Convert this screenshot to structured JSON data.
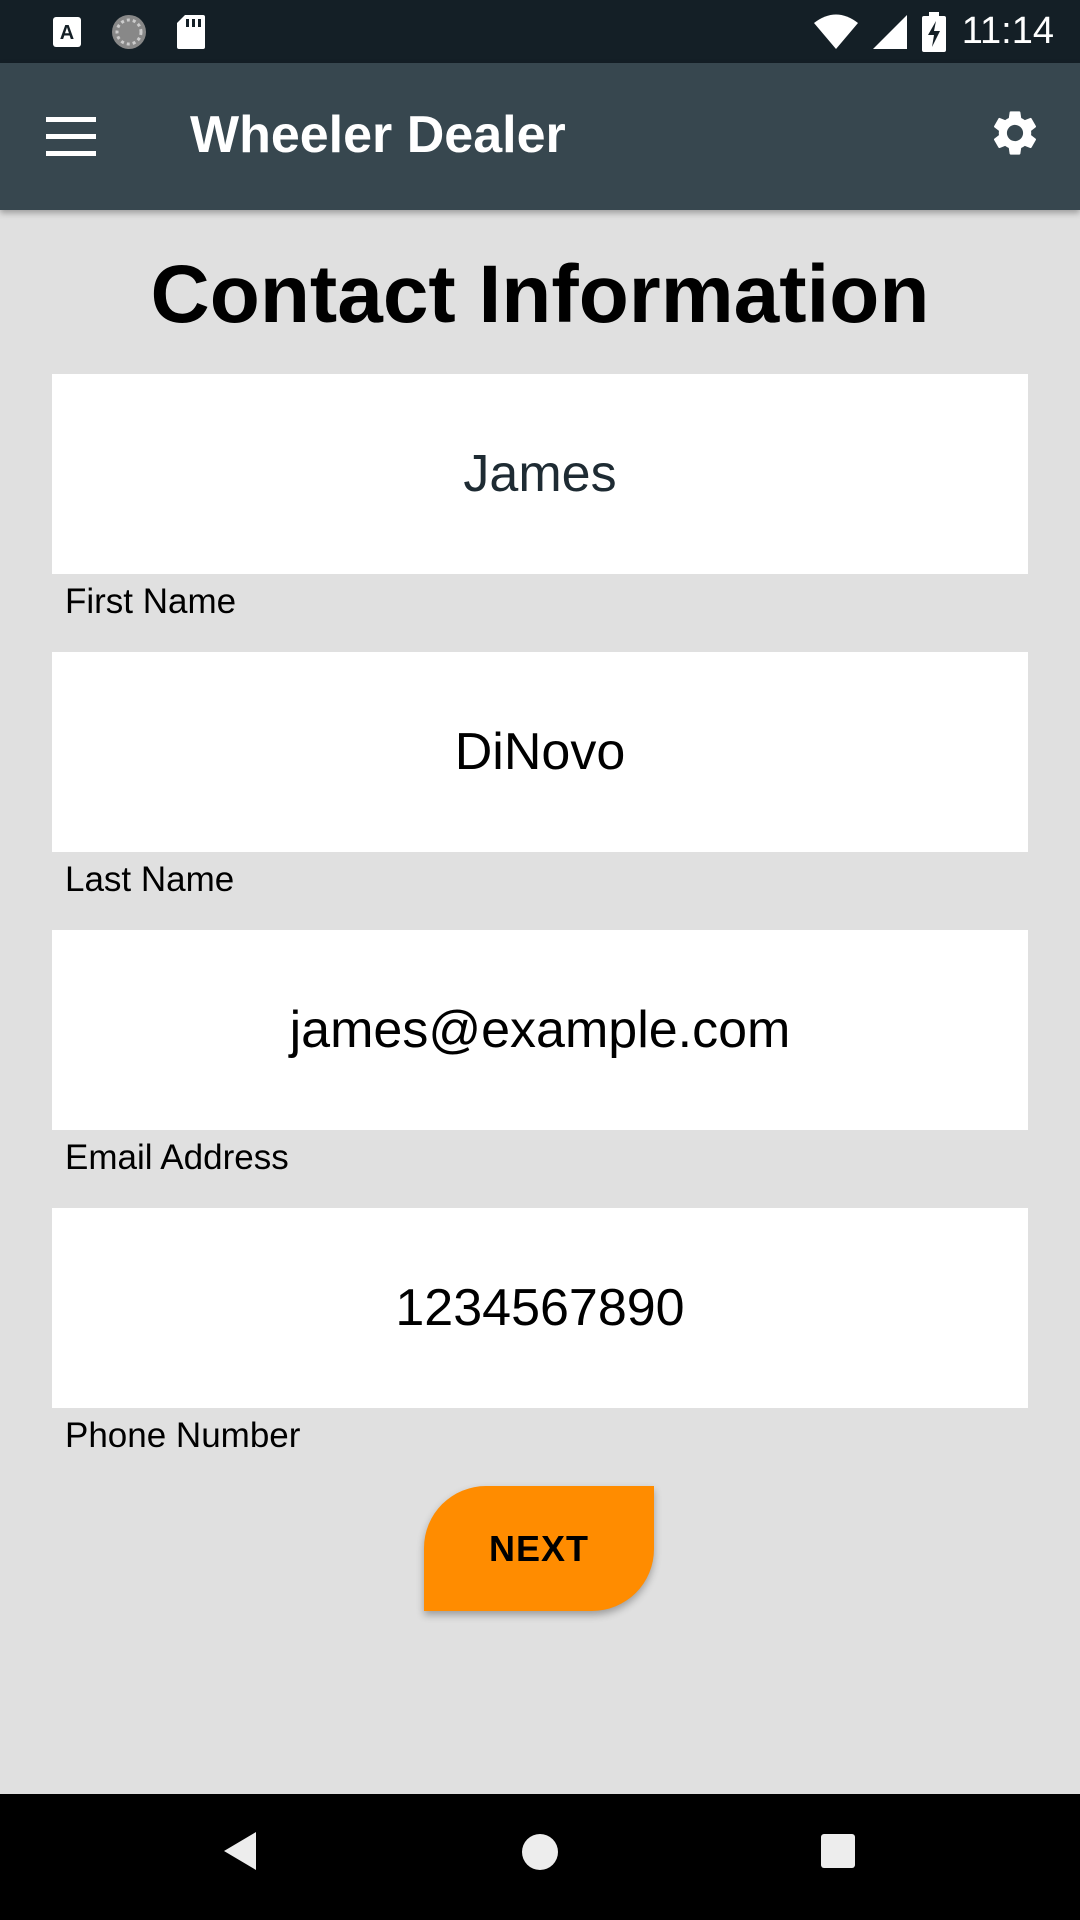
{
  "status_bar": {
    "time": "11:14",
    "icons": [
      "a-notification-icon",
      "loading-icon",
      "sd-card-icon",
      "wifi-icon",
      "signal-icon",
      "battery-charging-icon"
    ]
  },
  "app_bar": {
    "title": "Wheeler Dealer",
    "menu_icon": "menu-icon",
    "settings_icon": "gear-icon",
    "background": "#37474f"
  },
  "page": {
    "title": "Contact Information"
  },
  "form": {
    "first_name": {
      "value": "James",
      "label": "First Name",
      "text_color": "#1e2b33"
    },
    "last_name": {
      "value": "DiNovo",
      "label": "Last Name"
    },
    "email": {
      "value": "james@example.com",
      "label": "Email Address"
    },
    "phone": {
      "value": "1234567890",
      "label": "Phone Number"
    },
    "next_label": "NEXT",
    "next_color": "#ff8c00"
  },
  "nav_bar": {
    "icons": [
      "back-icon",
      "home-icon",
      "recents-icon"
    ]
  }
}
